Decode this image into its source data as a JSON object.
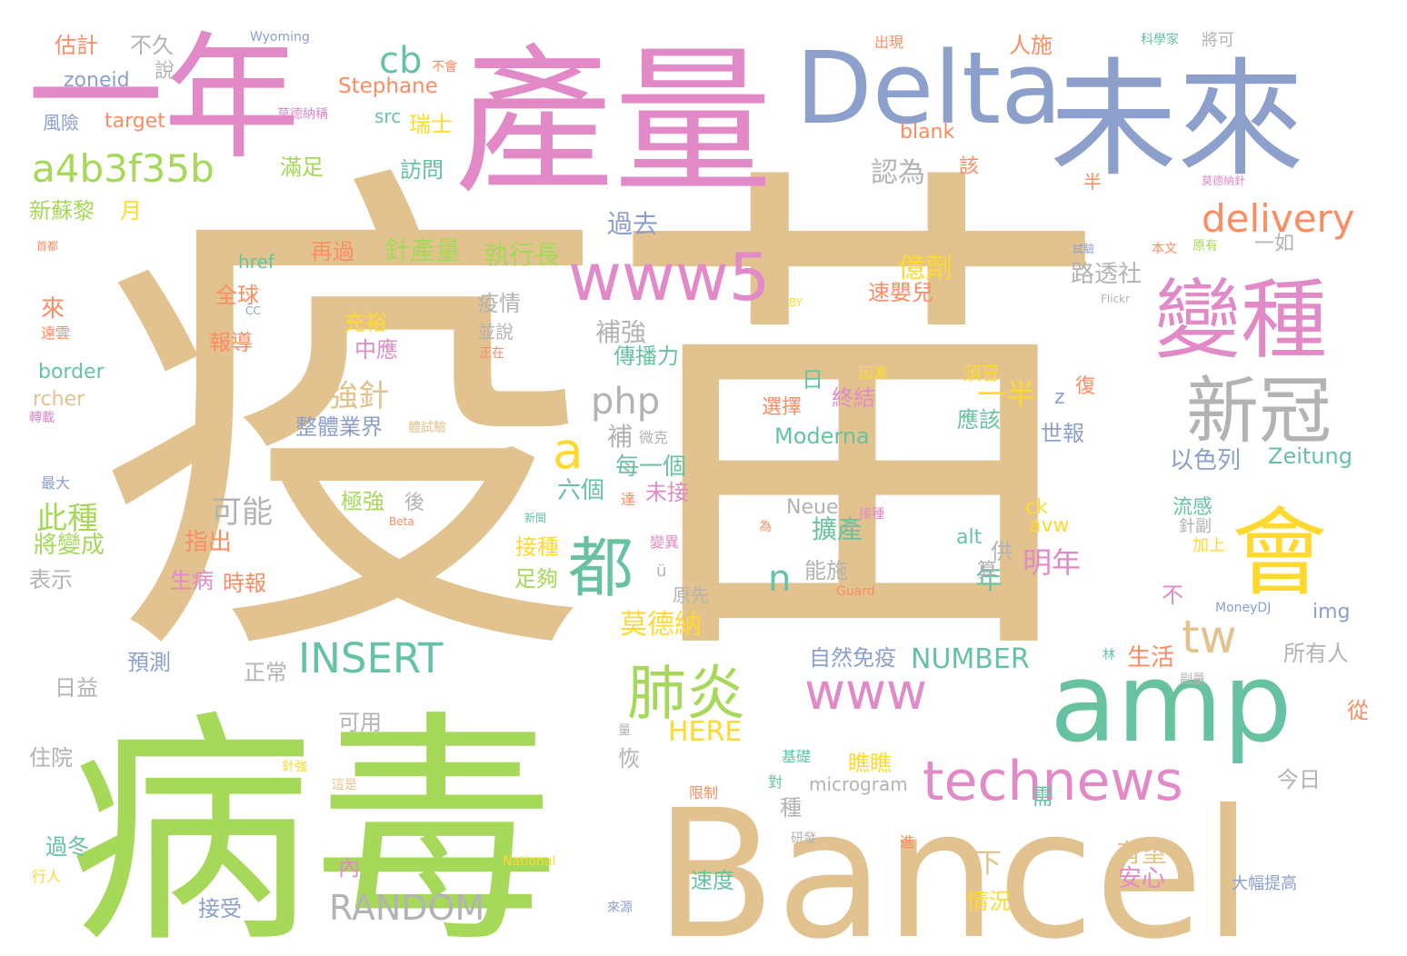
{
  "colors": {
    "tan": "#e2c38f",
    "green": "#a6d85a",
    "pink": "#e18ac7",
    "blue": "#8da0cb",
    "teal": "#67c39f",
    "yellow": "#ffd92f",
    "orange": "#fc8d62",
    "gray": "#b3b3b3"
  },
  "words": [
    {
      "text": "疫苗",
      "color": "tan"
    },
    {
      "text": "病毒",
      "color": "green"
    },
    {
      "text": "產量",
      "color": "pink"
    },
    {
      "text": "一年",
      "color": "pink"
    },
    {
      "text": "Delta",
      "color": "blue"
    },
    {
      "text": "未來",
      "color": "blue"
    },
    {
      "text": "Bancel",
      "color": "tan"
    },
    {
      "text": "amp",
      "color": "teal"
    },
    {
      "text": "變種",
      "color": "pink"
    },
    {
      "text": "新冠",
      "color": "gray"
    },
    {
      "text": "會",
      "color": "yellow"
    },
    {
      "text": "www5",
      "color": "pink"
    },
    {
      "text": "都",
      "color": "teal"
    },
    {
      "text": "肺炎",
      "color": "green"
    },
    {
      "text": "technews",
      "color": "pink"
    },
    {
      "text": "www",
      "color": "pink"
    },
    {
      "text": "INSERT",
      "color": "teal"
    },
    {
      "text": "tw",
      "color": "tan"
    },
    {
      "text": "delivery",
      "color": "orange"
    },
    {
      "text": "a4b3f35b",
      "color": "green"
    },
    {
      "text": "cb",
      "color": "teal"
    },
    {
      "text": "php",
      "color": "gray"
    },
    {
      "text": "a",
      "color": "yellow"
    },
    {
      "text": "RANDOM",
      "color": "gray"
    },
    {
      "text": "NUMBER",
      "color": "teal"
    },
    {
      "text": "Stephane",
      "color": "orange"
    },
    {
      "text": "zoneid",
      "color": "blue"
    },
    {
      "text": "target",
      "color": "orange"
    },
    {
      "text": "Moderna",
      "color": "teal"
    },
    {
      "text": "HERE",
      "color": "yellow"
    },
    {
      "text": "Zeitung",
      "color": "teal"
    },
    {
      "text": "border",
      "color": "teal"
    },
    {
      "text": "blank",
      "color": "orange"
    },
    {
      "text": "href",
      "color": "teal"
    },
    {
      "text": "rcher",
      "color": "tan"
    },
    {
      "text": "src",
      "color": "teal"
    },
    {
      "text": "img",
      "color": "blue"
    },
    {
      "text": "Neue",
      "color": "gray"
    },
    {
      "text": "avw",
      "color": "yellow"
    },
    {
      "text": "ck",
      "color": "yellow"
    },
    {
      "text": "alt",
      "color": "teal"
    },
    {
      "text": "microgram",
      "color": "gray"
    },
    {
      "text": "n",
      "color": "teal"
    },
    {
      "text": "z",
      "color": "blue"
    },
    {
      "text": "ü",
      "color": "gray"
    },
    {
      "text": "Wyoming",
      "color": "blue"
    },
    {
      "text": "National",
      "color": "yellow"
    },
    {
      "text": "MoneyDJ",
      "color": "blue"
    },
    {
      "text": "Flickr",
      "color": "gray"
    },
    {
      "text": "Beta",
      "color": "orange"
    },
    {
      "text": "Guard",
      "color": "orange"
    },
    {
      "text": "BY",
      "color": "yellow"
    },
    {
      "text": "CC",
      "color": "blue"
    },
    {
      "text": "估計",
      "color": "orange"
    },
    {
      "text": "不久",
      "color": "gray"
    },
    {
      "text": "說",
      "color": "gray"
    },
    {
      "text": "風險",
      "color": "blue"
    },
    {
      "text": "滿足",
      "color": "green"
    },
    {
      "text": "新蘇黎",
      "color": "green"
    },
    {
      "text": "月",
      "color": "yellow"
    },
    {
      "text": "瑞士",
      "color": "yellow"
    },
    {
      "text": "訪問",
      "color": "teal"
    },
    {
      "text": "人施",
      "color": "orange"
    },
    {
      "text": "認為",
      "color": "gray"
    },
    {
      "text": "該",
      "color": "orange"
    },
    {
      "text": "半",
      "color": "orange"
    },
    {
      "text": "過去",
      "color": "blue"
    },
    {
      "text": "全球",
      "color": "orange"
    },
    {
      "text": "再過",
      "color": "orange"
    },
    {
      "text": "針產量",
      "color": "green"
    },
    {
      "text": "執行長",
      "color": "green"
    },
    {
      "text": "億劑",
      "color": "yellow"
    },
    {
      "text": "路透社",
      "color": "gray"
    },
    {
      "text": "一如",
      "color": "gray"
    },
    {
      "text": "疫情",
      "color": "gray"
    },
    {
      "text": "並說",
      "color": "gray"
    },
    {
      "text": "充裕",
      "color": "yellow"
    },
    {
      "text": "補強",
      "color": "gray"
    },
    {
      "text": "速嬰兒",
      "color": "orange"
    },
    {
      "text": "來",
      "color": "orange"
    },
    {
      "text": "報導",
      "color": "orange"
    },
    {
      "text": "中應",
      "color": "pink"
    },
    {
      "text": "傳播力",
      "color": "teal"
    },
    {
      "text": "強針",
      "color": "tan"
    },
    {
      "text": "一半",
      "color": "yellow"
    },
    {
      "text": "復",
      "color": "orange"
    },
    {
      "text": "須冒",
      "color": "yellow"
    },
    {
      "text": "日",
      "color": "teal"
    },
    {
      "text": "終結",
      "color": "pink"
    },
    {
      "text": "選擇",
      "color": "orange"
    },
    {
      "text": "應該",
      "color": "teal"
    },
    {
      "text": "世報",
      "color": "blue"
    },
    {
      "text": "整體業界",
      "color": "blue"
    },
    {
      "text": "補",
      "color": "gray"
    },
    {
      "text": "以色列",
      "color": "blue"
    },
    {
      "text": "每一個",
      "color": "teal"
    },
    {
      "text": "六個",
      "color": "teal"
    },
    {
      "text": "未接",
      "color": "pink"
    },
    {
      "text": "可能",
      "color": "gray"
    },
    {
      "text": "此種",
      "color": "green"
    },
    {
      "text": "將變成",
      "color": "green"
    },
    {
      "text": "極強",
      "color": "green"
    },
    {
      "text": "後",
      "color": "gray"
    },
    {
      "text": "流感",
      "color": "teal"
    },
    {
      "text": "指出",
      "color": "orange"
    },
    {
      "text": "擴產",
      "color": "teal"
    },
    {
      "text": "供",
      "color": "gray"
    },
    {
      "text": "針副",
      "color": "gray"
    },
    {
      "text": "加上",
      "color": "yellow"
    },
    {
      "text": "明年",
      "color": "pink"
    },
    {
      "text": "年",
      "color": "teal"
    },
    {
      "text": "能施",
      "color": "gray"
    },
    {
      "text": "算",
      "color": "gray"
    },
    {
      "text": "表示",
      "color": "gray"
    },
    {
      "text": "生病",
      "color": "pink"
    },
    {
      "text": "時報",
      "color": "orange"
    },
    {
      "text": "接種",
      "color": "yellow"
    },
    {
      "text": "足夠",
      "color": "green"
    },
    {
      "text": "不",
      "color": "pink"
    },
    {
      "text": "莫德納",
      "color": "yellow"
    },
    {
      "text": "原先",
      "color": "gray"
    },
    {
      "text": "預測",
      "color": "blue"
    },
    {
      "text": "正常",
      "color": "gray"
    },
    {
      "text": "自然免疫",
      "color": "blue"
    },
    {
      "text": "生活",
      "color": "orange"
    },
    {
      "text": "林",
      "color": "teal"
    },
    {
      "text": "所有人",
      "color": "gray"
    },
    {
      "text": "日益",
      "color": "gray"
    },
    {
      "text": "可用",
      "color": "gray"
    },
    {
      "text": "瞧瞧",
      "color": "yellow"
    },
    {
      "text": "從",
      "color": "orange"
    },
    {
      "text": "住院",
      "color": "gray"
    },
    {
      "text": "恢",
      "color": "gray"
    },
    {
      "text": "種",
      "color": "gray"
    },
    {
      "text": "今日",
      "color": "gray"
    },
    {
      "text": "需",
      "color": "teal"
    },
    {
      "text": "過冬",
      "color": "teal"
    },
    {
      "text": "內",
      "color": "pink"
    },
    {
      "text": "下",
      "color": "tan"
    },
    {
      "text": "有望",
      "color": "tan"
    },
    {
      "text": "安心",
      "color": "pink"
    },
    {
      "text": "行人",
      "color": "yellow"
    },
    {
      "text": "接受",
      "color": "blue"
    },
    {
      "text": "速度",
      "color": "teal"
    },
    {
      "text": "情況",
      "color": "yellow"
    },
    {
      "text": "大幅提高",
      "color": "blue"
    },
    {
      "text": "出現",
      "color": "orange"
    },
    {
      "text": "不會",
      "color": "orange"
    },
    {
      "text": "科學家",
      "color": "teal"
    },
    {
      "text": "將可",
      "color": "gray"
    },
    {
      "text": "莫德納稱",
      "color": "pink"
    },
    {
      "text": "莫德納針",
      "color": "pink"
    },
    {
      "text": "首都",
      "color": "orange"
    },
    {
      "text": "試驗",
      "color": "blue"
    },
    {
      "text": "本文",
      "color": "orange"
    },
    {
      "text": "原有",
      "color": "green"
    },
    {
      "text": "遠雲",
      "color": "orange"
    },
    {
      "text": "正在",
      "color": "orange"
    },
    {
      "text": "轉載",
      "color": "pink"
    },
    {
      "text": "體試驗",
      "color": "tan"
    },
    {
      "text": "微克",
      "color": "gray"
    },
    {
      "text": "因素",
      "color": "yellow"
    },
    {
      "text": "最大",
      "color": "blue"
    },
    {
      "text": "達",
      "color": "orange"
    },
    {
      "text": "新聞",
      "color": "teal"
    },
    {
      "text": "為",
      "color": "orange"
    },
    {
      "text": "接種",
      "color": "pink"
    },
    {
      "text": "變異",
      "color": "pink"
    },
    {
      "text": "副量",
      "color": "gray"
    },
    {
      "text": "量",
      "color": "gray"
    },
    {
      "text": "基礎",
      "color": "teal"
    },
    {
      "text": "針強",
      "color": "yellow"
    },
    {
      "text": "對",
      "color": "teal"
    },
    {
      "text": "這是",
      "color": "tan"
    },
    {
      "text": "限制",
      "color": "orange"
    },
    {
      "text": "研發",
      "color": "gray"
    },
    {
      "text": "進",
      "color": "orange"
    },
    {
      "text": "來源",
      "color": "blue"
    }
  ]
}
